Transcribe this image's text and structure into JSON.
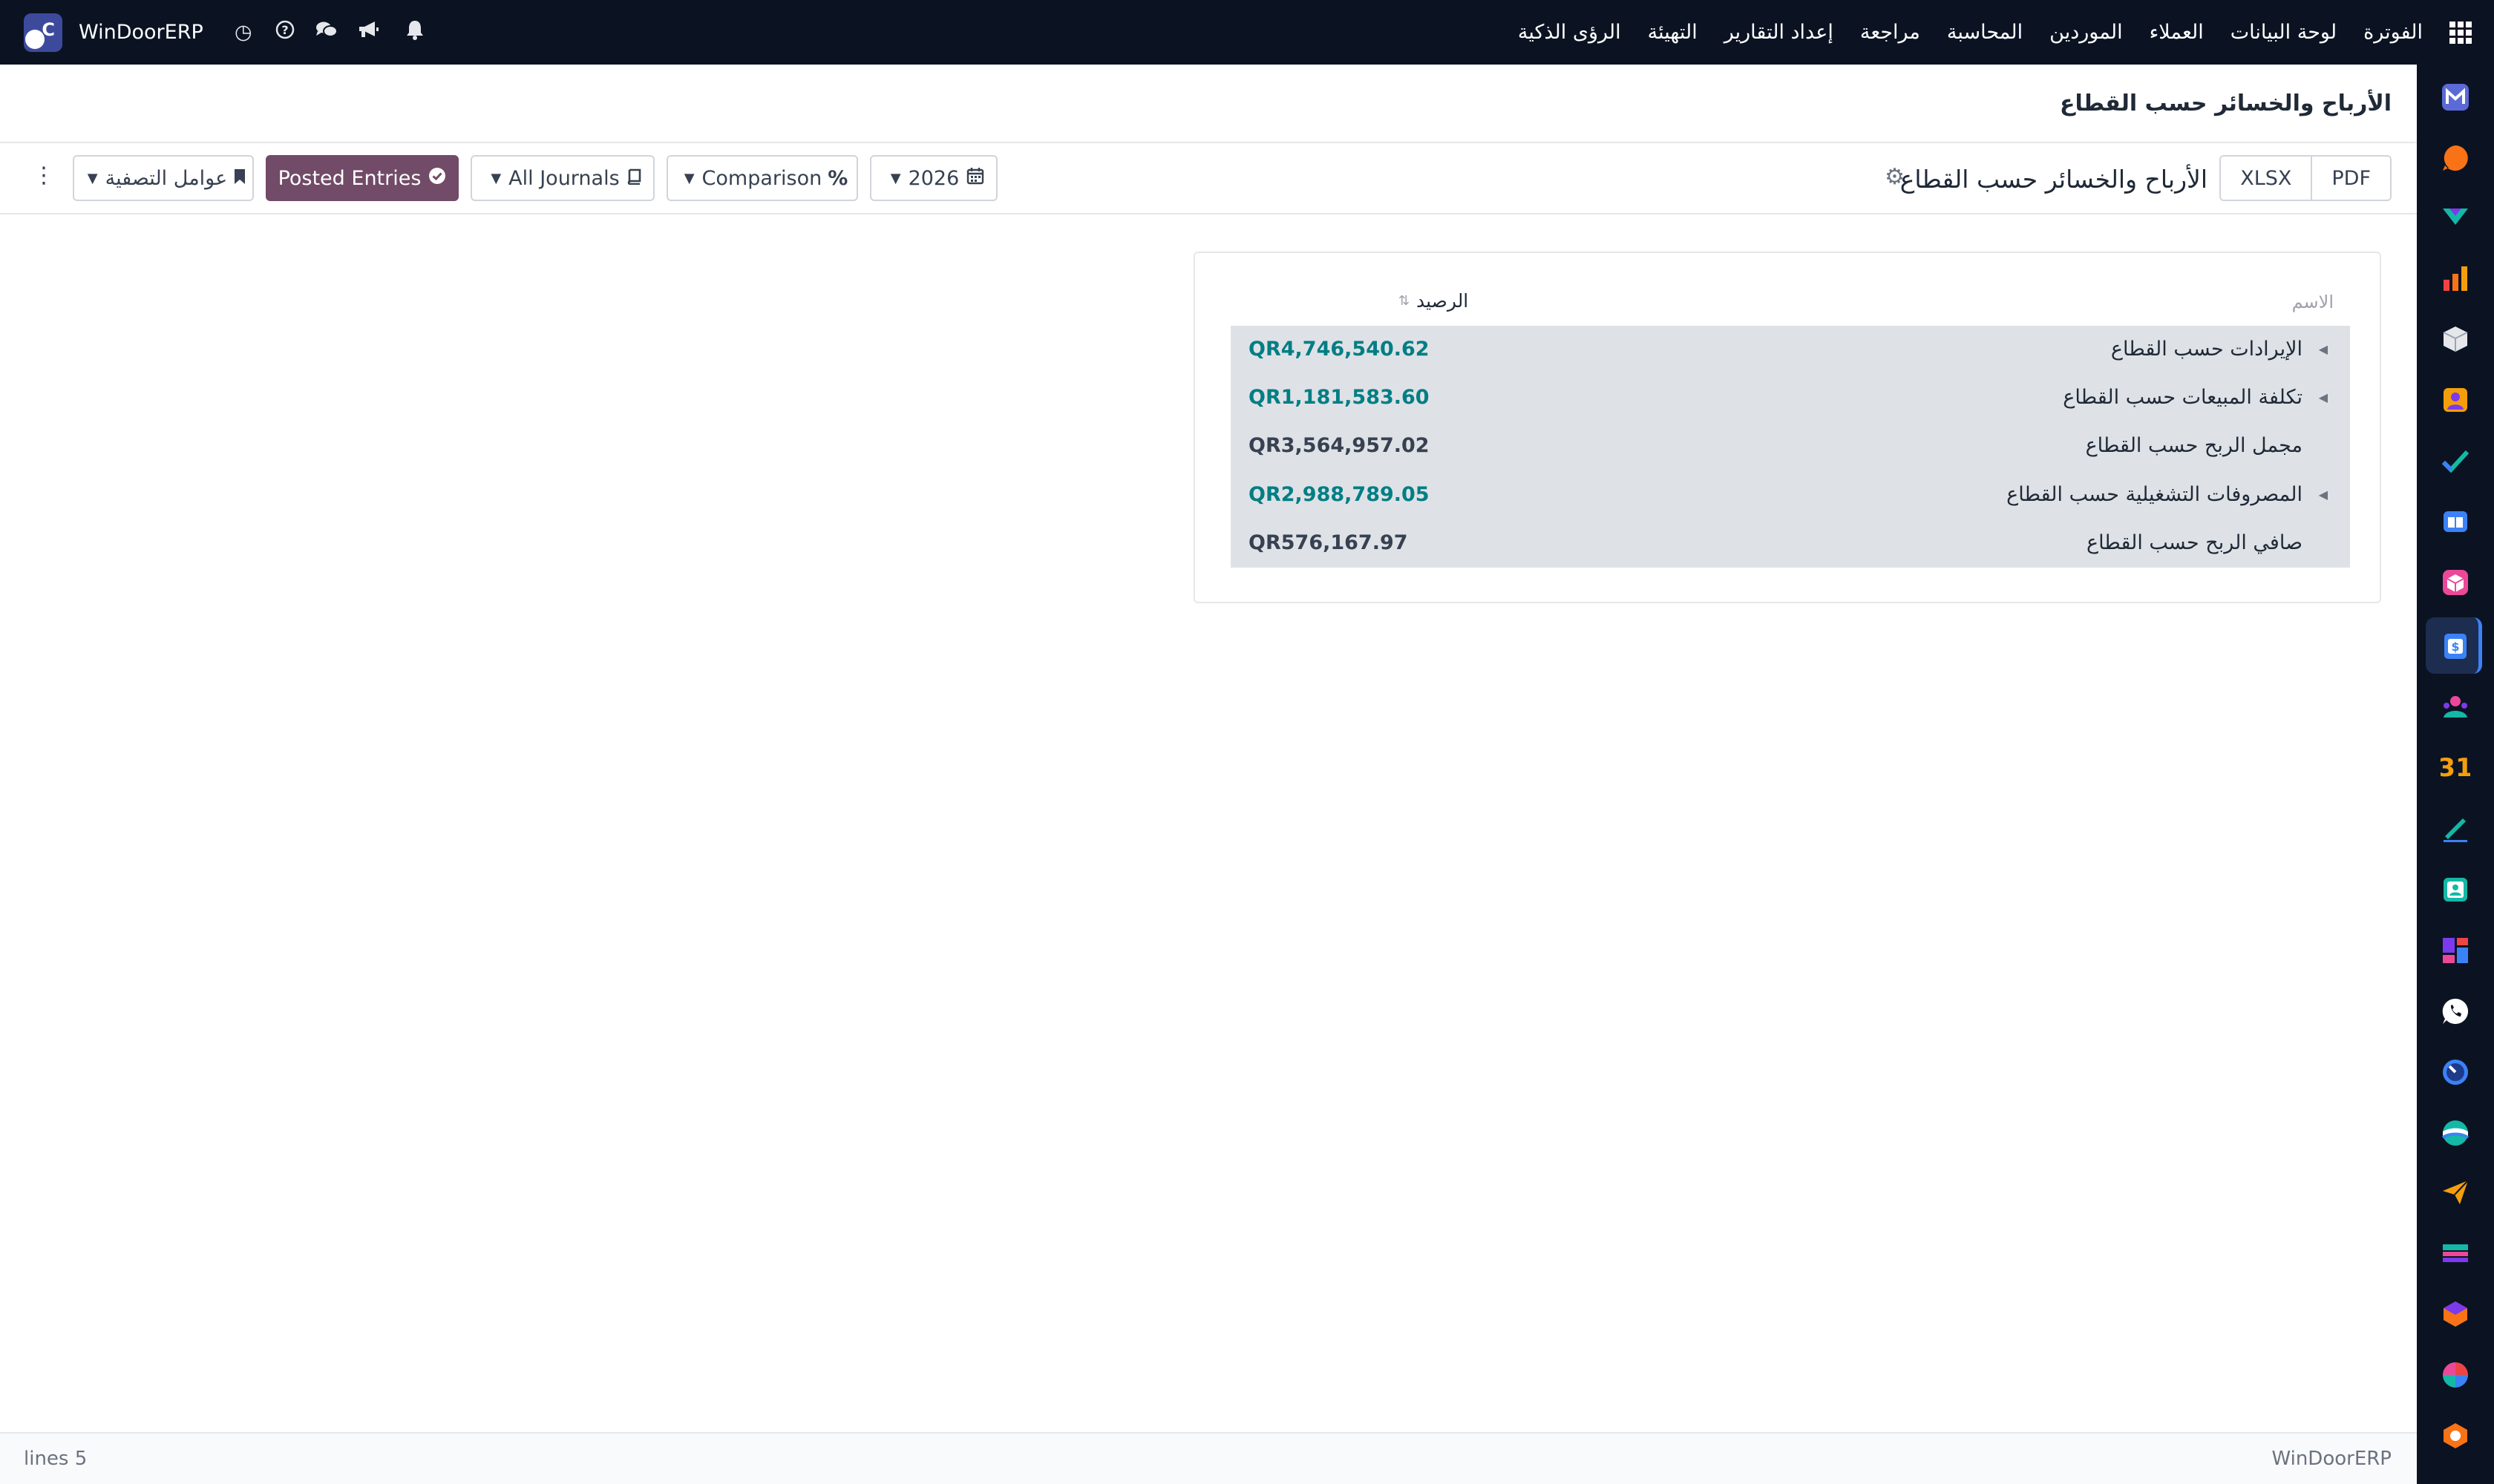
{
  "navbar": {
    "brand_name": "WinDoorERP",
    "menu": [
      "الفوترة",
      "لوحة البيانات",
      "العملاء",
      "الموردين",
      "المحاسبة",
      "مراجعة",
      "إعداد التقارير",
      "التهيئة",
      "الرؤى الذكية"
    ],
    "icons": [
      "clock-icon",
      "help-icon",
      "chat-icon",
      "megaphone-icon",
      "bell-icon",
      "apps-grid-icon"
    ]
  },
  "page": {
    "title": "الأرباح والخسائر حسب القطاع"
  },
  "controls": {
    "pdf": "PDF",
    "xlsx": "XLSX",
    "report_title": "الأرباح والخسائر حسب القطاع",
    "year_filter": "2026",
    "comparison": "Comparison",
    "journals": "All Journals",
    "posted_entries": "Posted Entries",
    "filters": "عوامل التصفية"
  },
  "table": {
    "col_name": "الاسم",
    "col_balance": "الرصيد",
    "rows": [
      {
        "label": "الإيرادات حسب القطاع",
        "value": "QR4,746,540.62",
        "expandable": true
      },
      {
        "label": "تكلفة المبيعات حسب القطاع",
        "value": "QR1,181,583.60",
        "expandable": true
      },
      {
        "label": "مجمل الربح حسب القطاع",
        "value": "QR3,564,957.02",
        "expandable": false
      },
      {
        "label": "المصروفات التشغيلية حسب القطاع",
        "value": "QR2,988,789.05",
        "expandable": true
      },
      {
        "label": "صافي الربح حسب القطاع",
        "value": "QR576,167.97",
        "expandable": false
      }
    ]
  },
  "footer": {
    "lines": "lines 5",
    "brand": "WinDoorERP"
  },
  "colors": {
    "navbar_bg": "#0b1323",
    "primary": "#714b67",
    "link": "#017e84",
    "row_bg": "#dee2e6"
  }
}
